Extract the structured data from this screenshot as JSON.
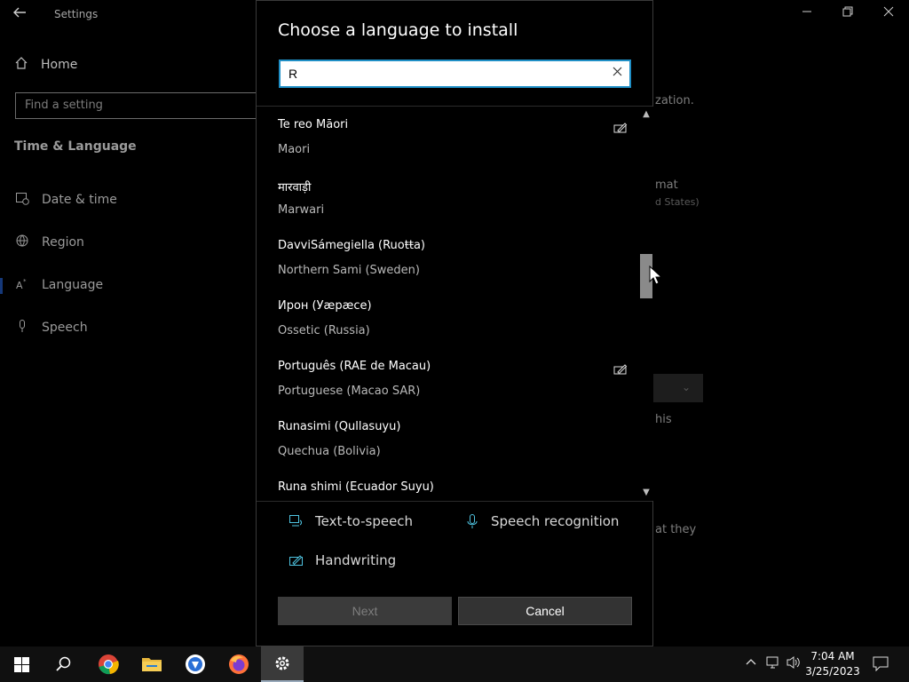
{
  "settings": {
    "app_title": "Settings",
    "home_label": "Home",
    "search_placeholder": "Find a setting",
    "section_title": "Time & Language",
    "nav": [
      {
        "label": "Date & time",
        "icon": "calendar-clock-icon"
      },
      {
        "label": "Region",
        "icon": "globe-icon"
      },
      {
        "label": "Language",
        "icon": "language-icon"
      },
      {
        "label": "Speech",
        "icon": "microphone-icon"
      }
    ],
    "background_fragments": [
      "zation.",
      "mat",
      "d States)",
      "his",
      "at they"
    ]
  },
  "dialog": {
    "title": "Choose a language to install",
    "search_value": "R",
    "languages": [
      {
        "native": "Te reo Māori",
        "english": "Maori",
        "handwriting": true
      },
      {
        "native": "मारवाड़ी",
        "english": "Marwari",
        "handwriting": false
      },
      {
        "native": "DavviSámegiella (Ruoŧŧa)",
        "english": "Northern Sami (Sweden)",
        "handwriting": false
      },
      {
        "native": "Ирон (Уæрæсе)",
        "english": "Ossetic (Russia)",
        "handwriting": false
      },
      {
        "native": "Português (RAE de Macau)",
        "english": "Portuguese (Macao SAR)",
        "handwriting": true
      },
      {
        "native": "Runasimi (Qullasuyu)",
        "english": "Quechua (Bolivia)",
        "handwriting": false
      },
      {
        "native": "Runa shimi (Ecuador Suyu)",
        "english": "",
        "handwriting": false
      }
    ],
    "features": {
      "tts": "Text-to-speech",
      "speech": "Speech recognition",
      "handwriting": "Handwriting"
    },
    "next_label": "Next",
    "cancel_label": "Cancel"
  },
  "taskbar": {
    "time": "7:04 AM",
    "date": "3/25/2023"
  },
  "colors": {
    "accent": "#1f8fc6",
    "feature_icon": "#4fc3e0"
  }
}
